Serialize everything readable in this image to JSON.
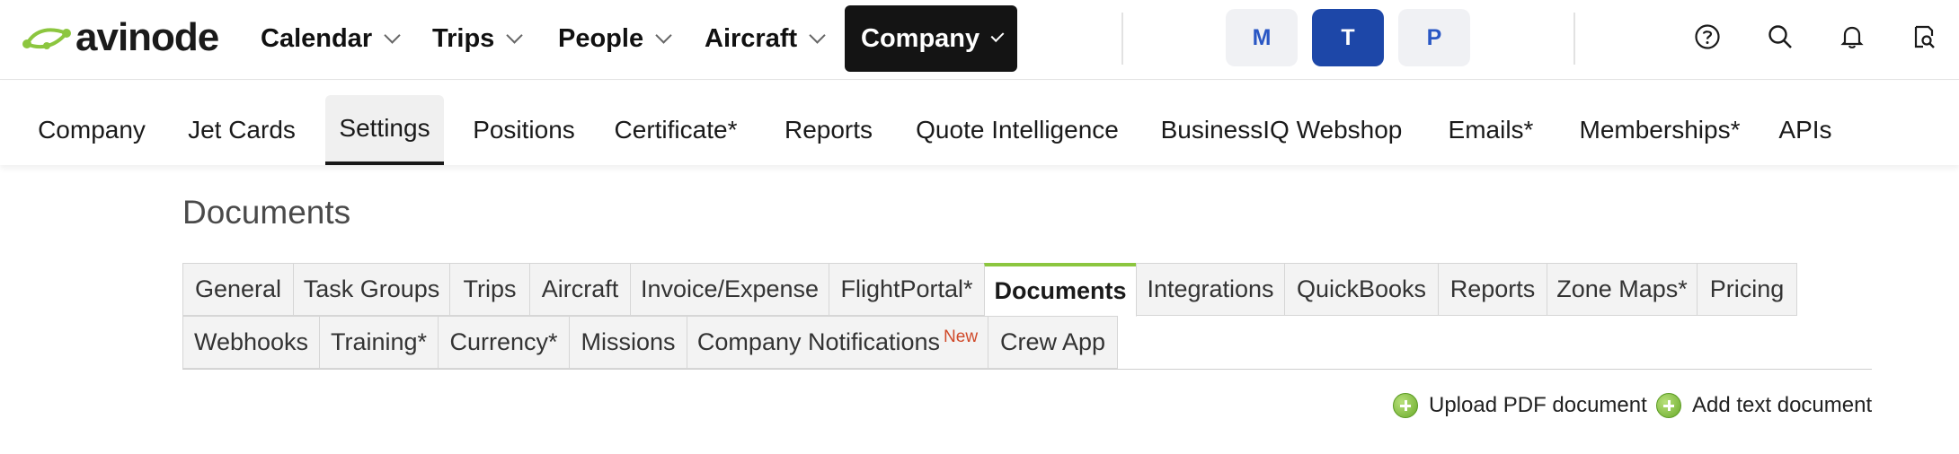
{
  "header": {
    "logo_text": "avinode",
    "nav": [
      {
        "label": "Calendar",
        "active": false
      },
      {
        "label": "Trips",
        "active": false
      },
      {
        "label": "People",
        "active": false
      },
      {
        "label": "Aircraft",
        "active": false
      },
      {
        "label": "Company",
        "active": true
      }
    ],
    "workspace_pills": [
      {
        "label": "M",
        "active": false
      },
      {
        "label": "T",
        "active": true
      },
      {
        "label": "P",
        "active": false
      }
    ],
    "icons": [
      "help-icon",
      "search-icon",
      "bell-icon",
      "settings-search-icon"
    ]
  },
  "subnav": {
    "items": [
      "Company",
      "Jet Cards",
      "Settings",
      "Positions",
      "Certificate*",
      "Reports",
      "Quote Intelligence",
      "BusinessIQ Webshop",
      "Emails*",
      "Memberships*",
      "APIs"
    ],
    "active": "Settings"
  },
  "page": {
    "title": "Documents",
    "tabs_row1": [
      "General",
      "Task Groups",
      "Trips",
      "Aircraft",
      "Invoice/Expense",
      "FlightPortal*",
      "Documents",
      "Integrations",
      "QuickBooks",
      "Reports",
      "Zone Maps*",
      "Pricing"
    ],
    "tabs_row2": [
      "Webhooks",
      "Training*",
      "Currency*",
      "Missions",
      "Company Notifications",
      "Crew App"
    ],
    "new_badge": "New",
    "active_tab": "Documents",
    "actions": {
      "upload_pdf": "Upload PDF document",
      "add_text": "Add text document"
    }
  },
  "colors": {
    "accent_green": "#8cc63f",
    "active_pill": "#1d47a8",
    "active_nav": "#141414",
    "new_badge": "#d04a2a"
  }
}
